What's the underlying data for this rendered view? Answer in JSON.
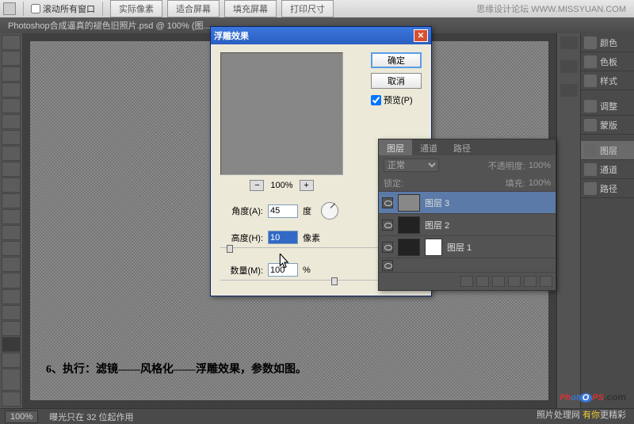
{
  "topbar": {
    "scroll_all": "滚动所有窗口",
    "btns": [
      "实际像素",
      "适合屏幕",
      "填充屏幕",
      "打印尺寸"
    ]
  },
  "brand": "思缘设计论坛  WWW.MISSYUAN.COM",
  "doctab": "Photoshop合成逼真的褪色旧照片.psd @ 100% (图...",
  "dialog": {
    "title": "浮雕效果",
    "ok": "确定",
    "cancel": "取消",
    "preview": "预览(P)",
    "zoom": "100%",
    "angle_label": "角度(A):",
    "angle_value": "45",
    "angle_unit": "度",
    "height_label": "高度(H):",
    "height_value": "10",
    "height_unit": "像素",
    "amount_label": "数量(M):",
    "amount_value": "100",
    "amount_unit": "%"
  },
  "layers": {
    "tabs": [
      "图层",
      "通道",
      "路径"
    ],
    "blend": "正常",
    "opacity_label": "不透明度:",
    "opacity": "100%",
    "lock": "锁定:",
    "fill_label": "填充:",
    "fill": "100%",
    "rows": [
      "图层 3",
      "图层 2",
      "图层 1"
    ]
  },
  "right_panels": {
    "items": [
      "颜色",
      "色板",
      "样式",
      "调整",
      "蒙版",
      "图层",
      "通道",
      "路径"
    ]
  },
  "caption": "6、执行：滤镜——风格化——浮雕效果，参数如图。",
  "status": {
    "zoom": "100%",
    "text": "曝光只在 32 位起作用"
  },
  "footer": {
    "site": "照片处理网",
    "slogan1": "有你",
    "slogan2": "更精彩"
  }
}
